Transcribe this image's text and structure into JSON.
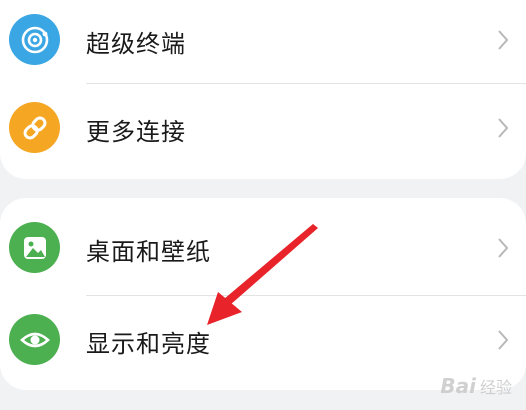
{
  "settings": {
    "group1": [
      {
        "label": "超级终端",
        "icon": "super-device-icon",
        "color": "#3aa6e3"
      },
      {
        "label": "更多连接",
        "icon": "link-icon",
        "color": "#f5a623"
      }
    ],
    "group2": [
      {
        "label": "桌面和壁纸",
        "icon": "wallpaper-icon",
        "color": "#4caf50"
      },
      {
        "label": "显示和亮度",
        "icon": "eye-icon",
        "color": "#4caf50"
      }
    ]
  },
  "watermark": {
    "logo": "Bai",
    "text": "经验"
  },
  "colors": {
    "annotation_arrow": "#e8232a",
    "background": "#f1f2f4",
    "card": "#ffffff"
  }
}
